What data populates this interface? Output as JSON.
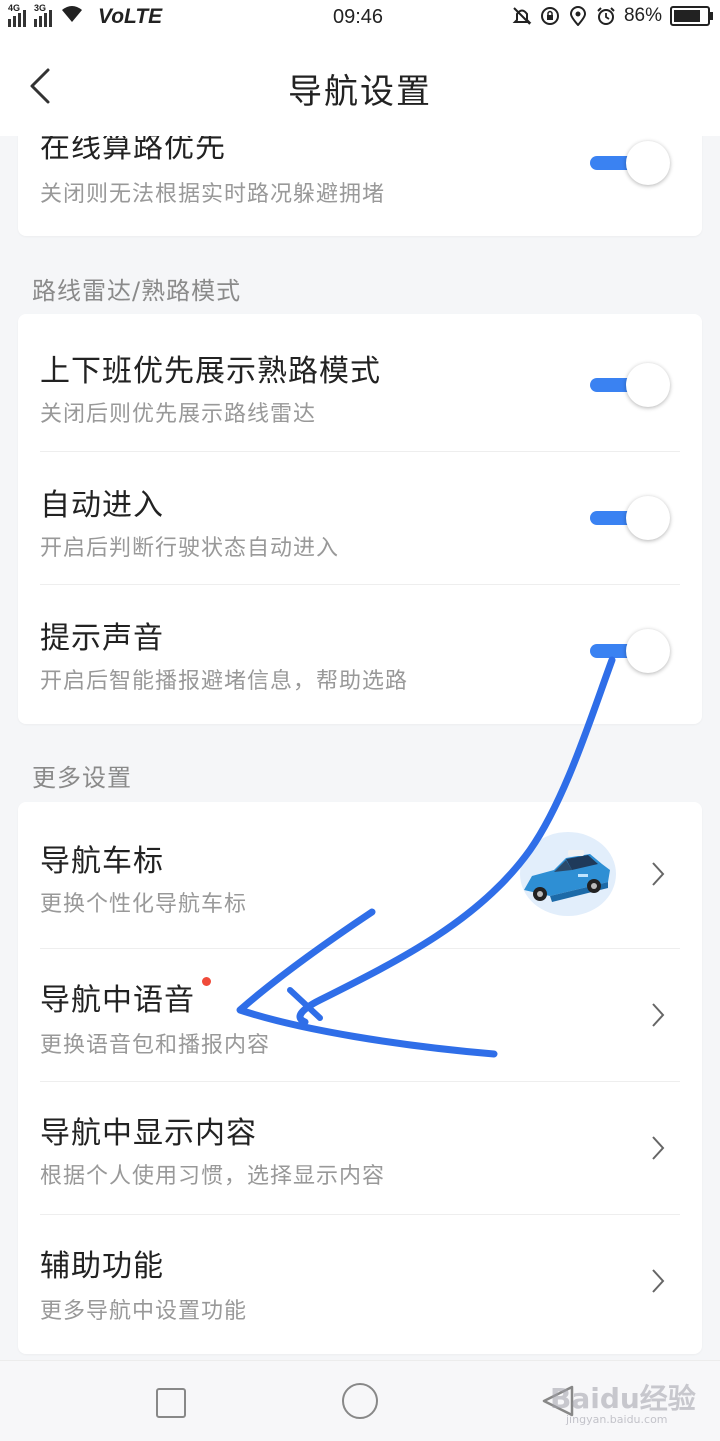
{
  "status_bar": {
    "net1": "4G",
    "net2": "3G",
    "volte": "VoLTE",
    "time": "09:46",
    "battery": "86%"
  },
  "header": {
    "title": "导航设置"
  },
  "card1": {
    "title": "在线算路优先",
    "subtitle": "关闭则无法根据实时路况躲避拥堵",
    "toggle_on": true
  },
  "section_radar": "路线雷达/熟路模式",
  "card2": {
    "rows": [
      {
        "title": "上下班优先展示熟路模式",
        "subtitle": "关闭后则优先展示路线雷达",
        "toggle_on": true
      },
      {
        "title": "自动进入",
        "subtitle": "开启后判断行驶状态自动进入",
        "toggle_on": true
      },
      {
        "title": "提示声音",
        "subtitle": "开启后智能播报避堵信息，帮助选路",
        "toggle_on": true
      }
    ]
  },
  "section_more": "更多设置",
  "card3": {
    "rows": [
      {
        "title": "导航车标",
        "subtitle": "更换个性化导航车标"
      },
      {
        "title": "导航中语音",
        "subtitle": "更换语音包和播报内容"
      },
      {
        "title": "导航中显示内容",
        "subtitle": "根据个人使用习惯，选择显示内容"
      },
      {
        "title": "辅助功能",
        "subtitle": "更多导航中设置功能"
      }
    ]
  },
  "watermark": {
    "text": "Baidu经验",
    "sub": "jingyan.baidu.com"
  },
  "colors": {
    "accent": "#3a82f2",
    "annotation": "#2f6ee8",
    "badge": "#f04b3a"
  }
}
